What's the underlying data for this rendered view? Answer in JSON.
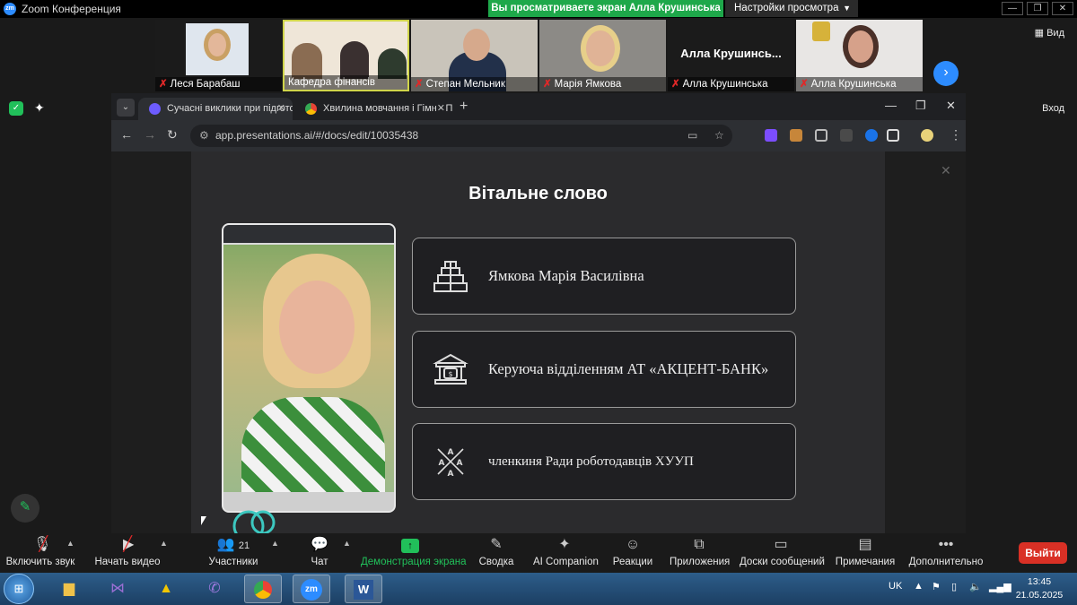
{
  "zoom_window": {
    "title": "Zoom Конференция",
    "share_banner": "Вы просматриваете экран Алла Крушинська",
    "view_settings": "Настройки просмотра",
    "side_view": "Вид",
    "side_enter": "Вход"
  },
  "participants": [
    {
      "name": "Леся Барабаш",
      "muted": true
    },
    {
      "name": "Кафедра фінансів",
      "muted": false
    },
    {
      "name": "Степан Мельник",
      "muted": true
    },
    {
      "name": "Марія Ямкова",
      "muted": true
    },
    {
      "name": "Алла Крушинська",
      "muted": true,
      "display_name": "Алла  Крушинсь..."
    },
    {
      "name": "Алла Крушинська",
      "muted": true
    }
  ],
  "browser": {
    "tab1": "Сучасні виклики при підготов",
    "tab2": "Хвилина мовчання і Гімн · По",
    "url": "app.presentations.ai/#/docs/edit/10035438"
  },
  "slide": {
    "title": "Вітальне слово",
    "cards": [
      {
        "icon": "pyramid-icon",
        "text": "Ямкова Марія Василівна"
      },
      {
        "icon": "bank-icon",
        "text": "Керуюча відділенням АТ «АКЦЕНТ-БАНК»"
      },
      {
        "icon": "network-icon",
        "text": "членкиня Ради роботодавців ХУУП"
      }
    ]
  },
  "toolbar": {
    "audio": "Включить звук",
    "video": "Начать видео",
    "participants": "Участники",
    "participants_count": "21",
    "chat": "Чат",
    "share": "Демонстрация экрана",
    "summary": "Сводка",
    "ai": "AI Companion",
    "reactions": "Реакции",
    "apps": "Приложения",
    "boards": "Доски сообщений",
    "notes": "Примечания",
    "more": "Дополнительно",
    "leave": "Выйти"
  },
  "taskbar": {
    "lang": "UK",
    "time": "13:45",
    "date": "21.05.2025"
  },
  "colors": {
    "accent_green": "#21c05a",
    "zoom_blue": "#2d8cff",
    "leave_red": "#d93025"
  }
}
